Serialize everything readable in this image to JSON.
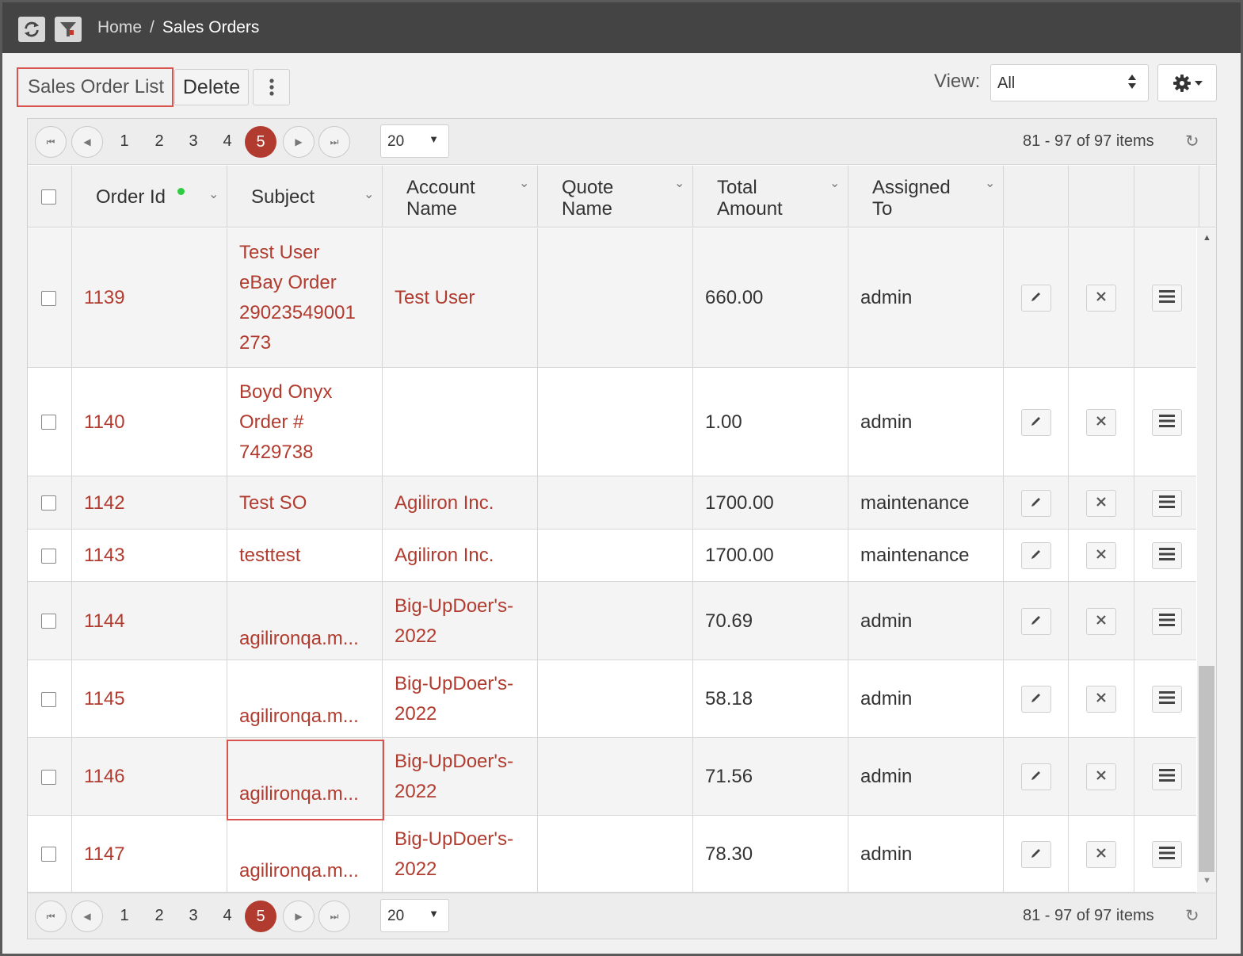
{
  "breadcrumb": {
    "home": "Home",
    "separator": "/",
    "current": "Sales Orders"
  },
  "toolbar": {
    "title": "Sales Order List",
    "delete_label": "Delete",
    "view_label": "View:",
    "view_value": "All"
  },
  "pager": {
    "pages": [
      "1",
      "2",
      "3",
      "4"
    ],
    "current_page": "5",
    "page_size": "20",
    "info": "81 - 97 of 97 items"
  },
  "columns": {
    "order_id": "Order Id",
    "subject": "Subject",
    "account_name": [
      "Account",
      "Name"
    ],
    "quote_name": [
      "Quote",
      "Name"
    ],
    "total_amount": [
      "Total",
      "Amount"
    ],
    "assigned_to": [
      "Assigned",
      "To"
    ]
  },
  "rows": [
    {
      "order_id": "1139",
      "subject_lines": [
        "Test User",
        "eBay Order",
        "29023549001",
        "273"
      ],
      "account_lines": [
        "Test User"
      ],
      "quote": "",
      "total": "660.00",
      "assigned": "admin"
    },
    {
      "order_id": "1140",
      "subject_lines": [
        "Boyd Onyx",
        "Order #",
        "7429738"
      ],
      "account_lines": [],
      "quote": "",
      "total": "1.00",
      "assigned": "admin"
    },
    {
      "order_id": "1142",
      "subject_lines": [
        "Test SO"
      ],
      "account_lines": [
        "Agiliron Inc."
      ],
      "quote": "",
      "total": "1700.00",
      "assigned": "maintenance"
    },
    {
      "order_id": "1143",
      "subject_lines": [
        "testtest"
      ],
      "account_lines": [
        "Agiliron Inc."
      ],
      "quote": "",
      "total": "1700.00",
      "assigned": "maintenance"
    },
    {
      "order_id": "1144",
      "subject_lines": [
        "agilironqa.m..."
      ],
      "account_lines": [
        "Big-UpDoer's-",
        "2022"
      ],
      "quote": "",
      "total": "70.69",
      "assigned": "admin"
    },
    {
      "order_id": "1145",
      "subject_lines": [
        "agilironqa.m..."
      ],
      "account_lines": [
        "Big-UpDoer's-",
        "2022"
      ],
      "quote": "",
      "total": "58.18",
      "assigned": "admin"
    },
    {
      "order_id": "1146",
      "subject_lines": [
        "agilironqa.m..."
      ],
      "account_lines": [
        "Big-UpDoer's-",
        "2022"
      ],
      "quote": "",
      "total": "71.56",
      "assigned": "admin"
    },
    {
      "order_id": "1147",
      "subject_lines": [
        "agilironqa.m..."
      ],
      "account_lines": [
        "Big-UpDoer's-",
        "2022"
      ],
      "quote": "",
      "total": "78.30",
      "assigned": "admin"
    }
  ],
  "icons": {
    "refresh": "refresh-icon",
    "filter": "filter-icon",
    "kebab": "vertical-ellipsis-icon",
    "gear": "gear-icon",
    "edit": "pencil-icon",
    "delete": "x-icon",
    "menu": "hamburger-icon"
  },
  "colors": {
    "accent": "#b13b2e",
    "topbar": "#444444",
    "highlight": "#d9534f",
    "status_dot": "#2ecc40"
  }
}
